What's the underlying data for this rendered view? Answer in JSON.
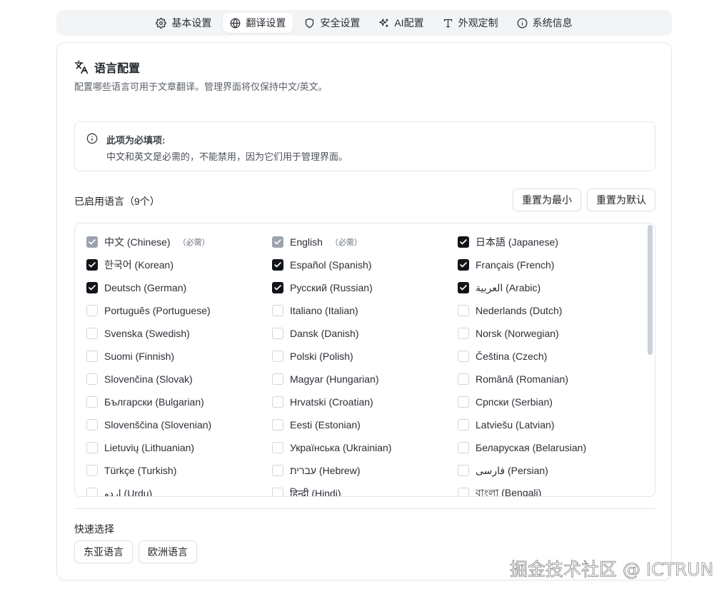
{
  "tabs": [
    {
      "label": "基本设置",
      "icon": "gear-icon",
      "active": false
    },
    {
      "label": "翻译设置",
      "icon": "globe-icon",
      "active": true
    },
    {
      "label": "安全设置",
      "icon": "shield-icon",
      "active": false
    },
    {
      "label": "AI配置",
      "icon": "sparkle-icon",
      "active": false
    },
    {
      "label": "外观定制",
      "icon": "type-icon",
      "active": false
    },
    {
      "label": "系统信息",
      "icon": "info-icon",
      "active": false
    }
  ],
  "card": {
    "title": "语言配置",
    "subtitle": "配置哪些语言可用于文章翻译。管理界面将仅保持中文/英文。"
  },
  "notice": {
    "title": "此项为必填项:",
    "text": "中文和英文是必需的，不能禁用，因为它们用于管理界面。"
  },
  "enabled": {
    "label": "已启用语言（9个）",
    "reset_min": "重置为最小",
    "reset_default": "重置为默认"
  },
  "required_tag": "（必需）",
  "languages": [
    {
      "label": "中文 (Chinese)",
      "state": "required"
    },
    {
      "label": "English",
      "state": "required"
    },
    {
      "label": "日本語 (Japanese)",
      "state": "checked"
    },
    {
      "label": "한국어 (Korean)",
      "state": "checked"
    },
    {
      "label": "Español (Spanish)",
      "state": "checked"
    },
    {
      "label": "Français (French)",
      "state": "checked"
    },
    {
      "label": "Deutsch (German)",
      "state": "checked"
    },
    {
      "label": "Русский (Russian)",
      "state": "checked"
    },
    {
      "label": "العربية (Arabic)",
      "state": "checked"
    },
    {
      "label": "Português (Portuguese)",
      "state": "unchecked"
    },
    {
      "label": "Italiano (Italian)",
      "state": "unchecked"
    },
    {
      "label": "Nederlands (Dutch)",
      "state": "unchecked"
    },
    {
      "label": "Svenska (Swedish)",
      "state": "unchecked"
    },
    {
      "label": "Dansk (Danish)",
      "state": "unchecked"
    },
    {
      "label": "Norsk (Norwegian)",
      "state": "unchecked"
    },
    {
      "label": "Suomi (Finnish)",
      "state": "unchecked"
    },
    {
      "label": "Polski (Polish)",
      "state": "unchecked"
    },
    {
      "label": "Čeština (Czech)",
      "state": "unchecked"
    },
    {
      "label": "Slovenčina (Slovak)",
      "state": "unchecked"
    },
    {
      "label": "Magyar (Hungarian)",
      "state": "unchecked"
    },
    {
      "label": "Română (Romanian)",
      "state": "unchecked"
    },
    {
      "label": "Български (Bulgarian)",
      "state": "unchecked"
    },
    {
      "label": "Hrvatski (Croatian)",
      "state": "unchecked"
    },
    {
      "label": "Српски (Serbian)",
      "state": "unchecked"
    },
    {
      "label": "Slovenščina (Slovenian)",
      "state": "unchecked"
    },
    {
      "label": "Eesti (Estonian)",
      "state": "unchecked"
    },
    {
      "label": "Latviešu (Latvian)",
      "state": "unchecked"
    },
    {
      "label": "Lietuvių (Lithuanian)",
      "state": "unchecked"
    },
    {
      "label": "Українська (Ukrainian)",
      "state": "unchecked"
    },
    {
      "label": "Беларуская (Belarusian)",
      "state": "unchecked"
    },
    {
      "label": "Türkçe (Turkish)",
      "state": "unchecked"
    },
    {
      "label": "עברית (Hebrew)",
      "state": "unchecked"
    },
    {
      "label": "فارسی (Persian)",
      "state": "unchecked"
    },
    {
      "label": "اردو (Urdu)",
      "state": "unchecked"
    },
    {
      "label": "हिन्दी (Hindi)",
      "state": "unchecked"
    },
    {
      "label": "বাংলা (Bengali)",
      "state": "unchecked"
    }
  ],
  "quick": {
    "label": "快速选择",
    "east_asia": "东亚语言",
    "europe": "欧洲语言"
  },
  "watermark": "掘金技术社区 @ ICTRUN",
  "colors": {
    "checked": "#111418",
    "required": "#9ca3af",
    "border": "#e5e7eb",
    "tabs_bg": "#f3f4f6"
  }
}
